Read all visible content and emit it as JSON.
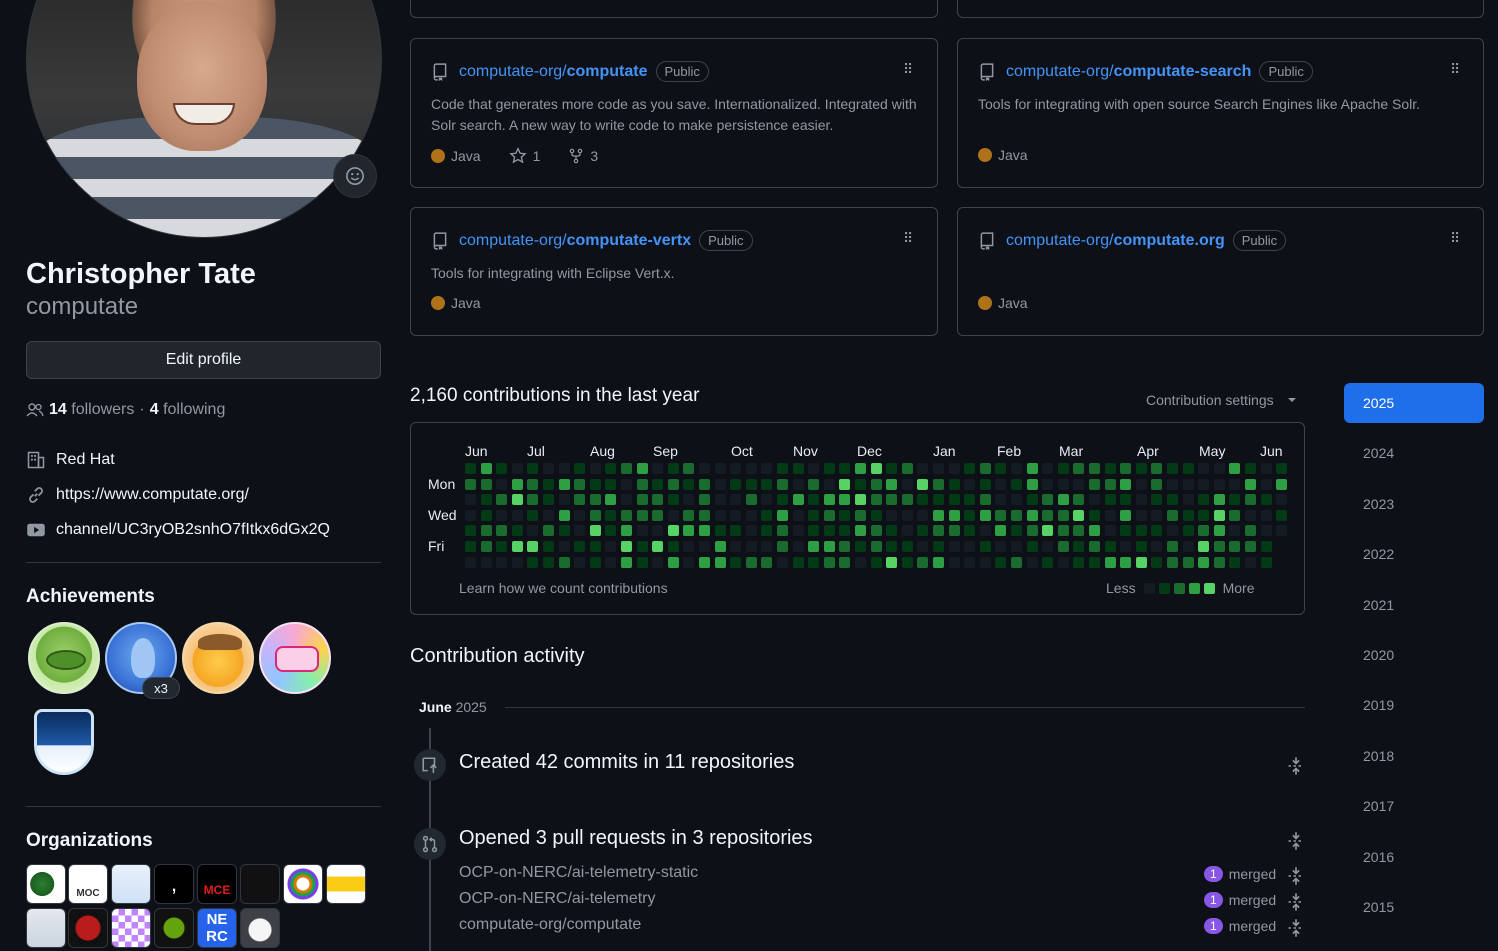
{
  "profile": {
    "name": "Christopher Tate",
    "login": "computate",
    "edit_profile_label": "Edit profile",
    "followers_count": "14",
    "followers_label": "followers",
    "following_count": "4",
    "following_label": "following",
    "separator": "·",
    "company": "Red Hat",
    "website": "https://www.computate.org/",
    "youtube": "channel/UC3ryOB2snhO7fItkx6dGx2Q"
  },
  "achievements": {
    "title": "Achievements",
    "multiplier": "x3",
    "items": [
      "pair-extraordinaire",
      "pull-shark",
      "yolo-cowboy",
      "yolo",
      "arctic-code-vault"
    ]
  },
  "organizations": {
    "title": "Organizations",
    "labels": [
      "MOC",
      "MCE",
      "NE RC"
    ]
  },
  "repos": [
    {
      "owner": "computate-org/",
      "name": "computate",
      "visibility": "Public",
      "description": "Code that generates more code as you save. Internationalized. Integrated with Solr search. A new way to write code to make persistence easier.",
      "language": "Java",
      "stars": "1",
      "forks": "3"
    },
    {
      "owner": "computate-org/",
      "name": "computate-search",
      "visibility": "Public",
      "description": "Tools for integrating with open source Search Engines like Apache Solr.",
      "language": "Java"
    },
    {
      "owner": "computate-org/",
      "name": "computate-vertx",
      "visibility": "Public",
      "description": "Tools for integrating with Eclipse Vert.x.",
      "language": "Java"
    },
    {
      "owner": "computate-org/",
      "name": "computate.org",
      "visibility": "Public",
      "description": "",
      "language": "Java"
    }
  ],
  "contributions": {
    "title": "2,160 contributions in the last year",
    "settings_label": "Contribution settings",
    "months": [
      "Jun",
      "Jul",
      "Aug",
      "Sep",
      "Oct",
      "Nov",
      "Dec",
      "Jan",
      "Feb",
      "Mar",
      "Apr",
      "May",
      "Jun"
    ],
    "days": [
      "Mon",
      "Wed",
      "Fri"
    ],
    "learn_link": "Learn how we count contributions",
    "less_label": "Less",
    "more_label": "More",
    "colors": [
      "#151b23",
      "#033a16",
      "#196c2e",
      "#2ea043",
      "#56d364"
    ]
  },
  "years": [
    "2025",
    "2024",
    "2023",
    "2022",
    "2021",
    "2020",
    "2019",
    "2018",
    "2017",
    "2016",
    "2015"
  ],
  "activity": {
    "title": "Contribution activity",
    "month": "June",
    "year": "2025",
    "commits_summary": "Created 42 commits in 11 repositories",
    "pr_summary": "Opened 3 pull requests in 3 repositories",
    "pull_requests": [
      {
        "repo": "OCP-on-NERC/ai-telemetry-static",
        "count": "1",
        "status": "merged"
      },
      {
        "repo": "OCP-on-NERC/ai-telemetry",
        "count": "1",
        "status": "merged"
      },
      {
        "repo": "computate-org/computate",
        "count": "1",
        "status": "merged"
      }
    ]
  }
}
